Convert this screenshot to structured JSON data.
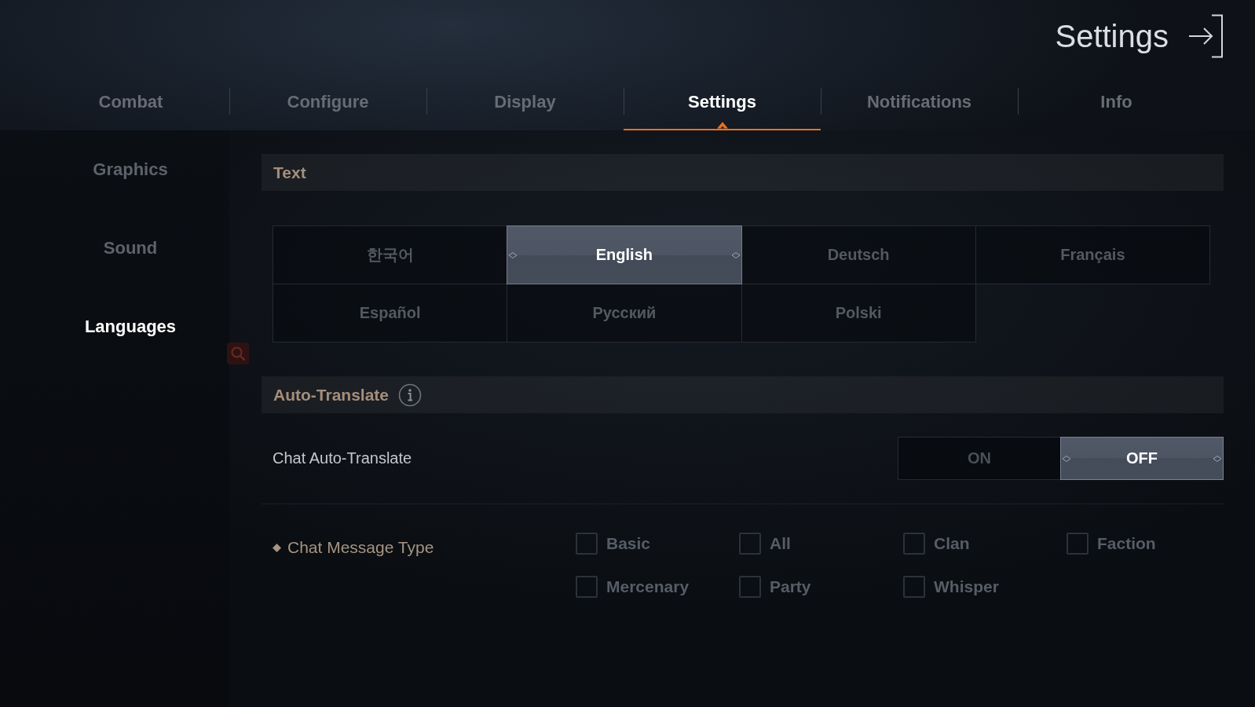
{
  "header": {
    "title": "Settings"
  },
  "tabs": [
    {
      "label": "Combat",
      "selected": false
    },
    {
      "label": "Configure",
      "selected": false
    },
    {
      "label": "Display",
      "selected": false
    },
    {
      "label": "Settings",
      "selected": true
    },
    {
      "label": "Notifications",
      "selected": false
    },
    {
      "label": "Info",
      "selected": false
    }
  ],
  "sidebar": {
    "items": [
      {
        "label": "Graphics",
        "selected": false
      },
      {
        "label": "Sound",
        "selected": false
      },
      {
        "label": "Languages",
        "selected": true
      }
    ]
  },
  "text_section": {
    "title": "Text",
    "languages": [
      {
        "label": "한국어",
        "selected": false
      },
      {
        "label": "English",
        "selected": true
      },
      {
        "label": "Deutsch",
        "selected": false
      },
      {
        "label": "Français",
        "selected": false
      },
      {
        "label": "Español",
        "selected": false
      },
      {
        "label": "Русский",
        "selected": false
      },
      {
        "label": "Polski",
        "selected": false
      }
    ]
  },
  "auto_translate_section": {
    "title": "Auto-Translate",
    "chat_auto_translate": {
      "label": "Chat Auto-Translate",
      "options": [
        {
          "label": "ON",
          "selected": false
        },
        {
          "label": "OFF",
          "selected": true
        }
      ]
    },
    "chat_message_type": {
      "label": "Chat Message Type",
      "disabled": true,
      "options": [
        {
          "label": "Basic",
          "checked": false
        },
        {
          "label": "All",
          "checked": false
        },
        {
          "label": "Clan",
          "checked": false
        },
        {
          "label": "Faction",
          "checked": false
        },
        {
          "label": "Mercenary",
          "checked": false
        },
        {
          "label": "Party",
          "checked": false
        },
        {
          "label": "Whisper",
          "checked": false
        }
      ]
    }
  }
}
